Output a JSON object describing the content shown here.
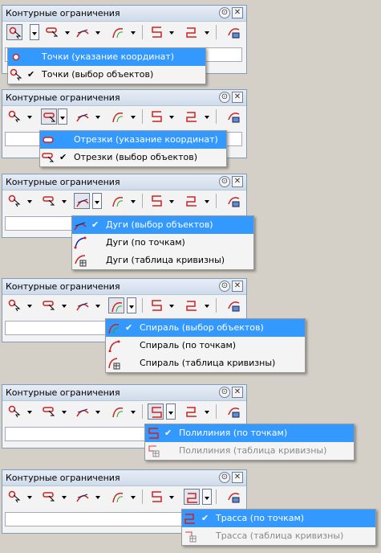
{
  "panel_title": "Контурные ограничения",
  "pin_icon": "pin-icon",
  "close_icon": "close-icon",
  "toolbar_icons": [
    "points-icon",
    "segments-icon",
    "arcs-icon",
    "spiral-icon",
    "polyline-icon",
    "route-icon",
    "settings-icon"
  ],
  "menus": [
    {
      "items": [
        {
          "label": "Точки (указание координат)",
          "selected": true,
          "checked": false,
          "enabled": true,
          "icon": "point-coord-icon"
        },
        {
          "label": "Точки (выбор объектов)",
          "selected": false,
          "checked": true,
          "enabled": true,
          "icon": "point-select-icon"
        }
      ]
    },
    {
      "items": [
        {
          "label": "Отрезки (указание координат)",
          "selected": true,
          "checked": false,
          "enabled": true,
          "icon": "segment-coord-icon"
        },
        {
          "label": "Отрезки (выбор объектов)",
          "selected": false,
          "checked": true,
          "enabled": true,
          "icon": "segment-select-icon"
        }
      ]
    },
    {
      "items": [
        {
          "label": "Дуги (выбор объектов)",
          "selected": true,
          "checked": true,
          "enabled": true,
          "icon": "arc-select-icon"
        },
        {
          "label": "Дуги (по точкам)",
          "selected": false,
          "checked": false,
          "enabled": true,
          "icon": "arc-points-icon"
        },
        {
          "label": "Дуги (таблица кривизны)",
          "selected": false,
          "checked": false,
          "enabled": true,
          "icon": "arc-table-icon"
        }
      ]
    },
    {
      "items": [
        {
          "label": "Спираль (выбор объектов)",
          "selected": true,
          "checked": true,
          "enabled": true,
          "icon": "spiral-select-icon"
        },
        {
          "label": "Спираль (по точкам)",
          "selected": false,
          "checked": false,
          "enabled": true,
          "icon": "spiral-points-icon"
        },
        {
          "label": "Спираль (таблица кривизны)",
          "selected": false,
          "checked": false,
          "enabled": true,
          "icon": "spiral-table-icon"
        }
      ]
    },
    {
      "items": [
        {
          "label": "Полилиния (по точкам)",
          "selected": true,
          "checked": true,
          "enabled": true,
          "icon": "polyline-points-icon"
        },
        {
          "label": "Полилиния (таблица кривизны)",
          "selected": false,
          "checked": false,
          "enabled": false,
          "icon": "polyline-table-icon"
        }
      ]
    },
    {
      "items": [
        {
          "label": "Трасса (по точкам)",
          "selected": true,
          "checked": true,
          "enabled": true,
          "icon": "route-points-icon"
        },
        {
          "label": "Трасса (таблица кривизны)",
          "selected": false,
          "checked": false,
          "enabled": false,
          "icon": "route-table-icon"
        }
      ]
    }
  ],
  "colors": {
    "selection": "#3399ff",
    "accent_red": "#cc2222",
    "accent_blue": "#2255aa"
  }
}
